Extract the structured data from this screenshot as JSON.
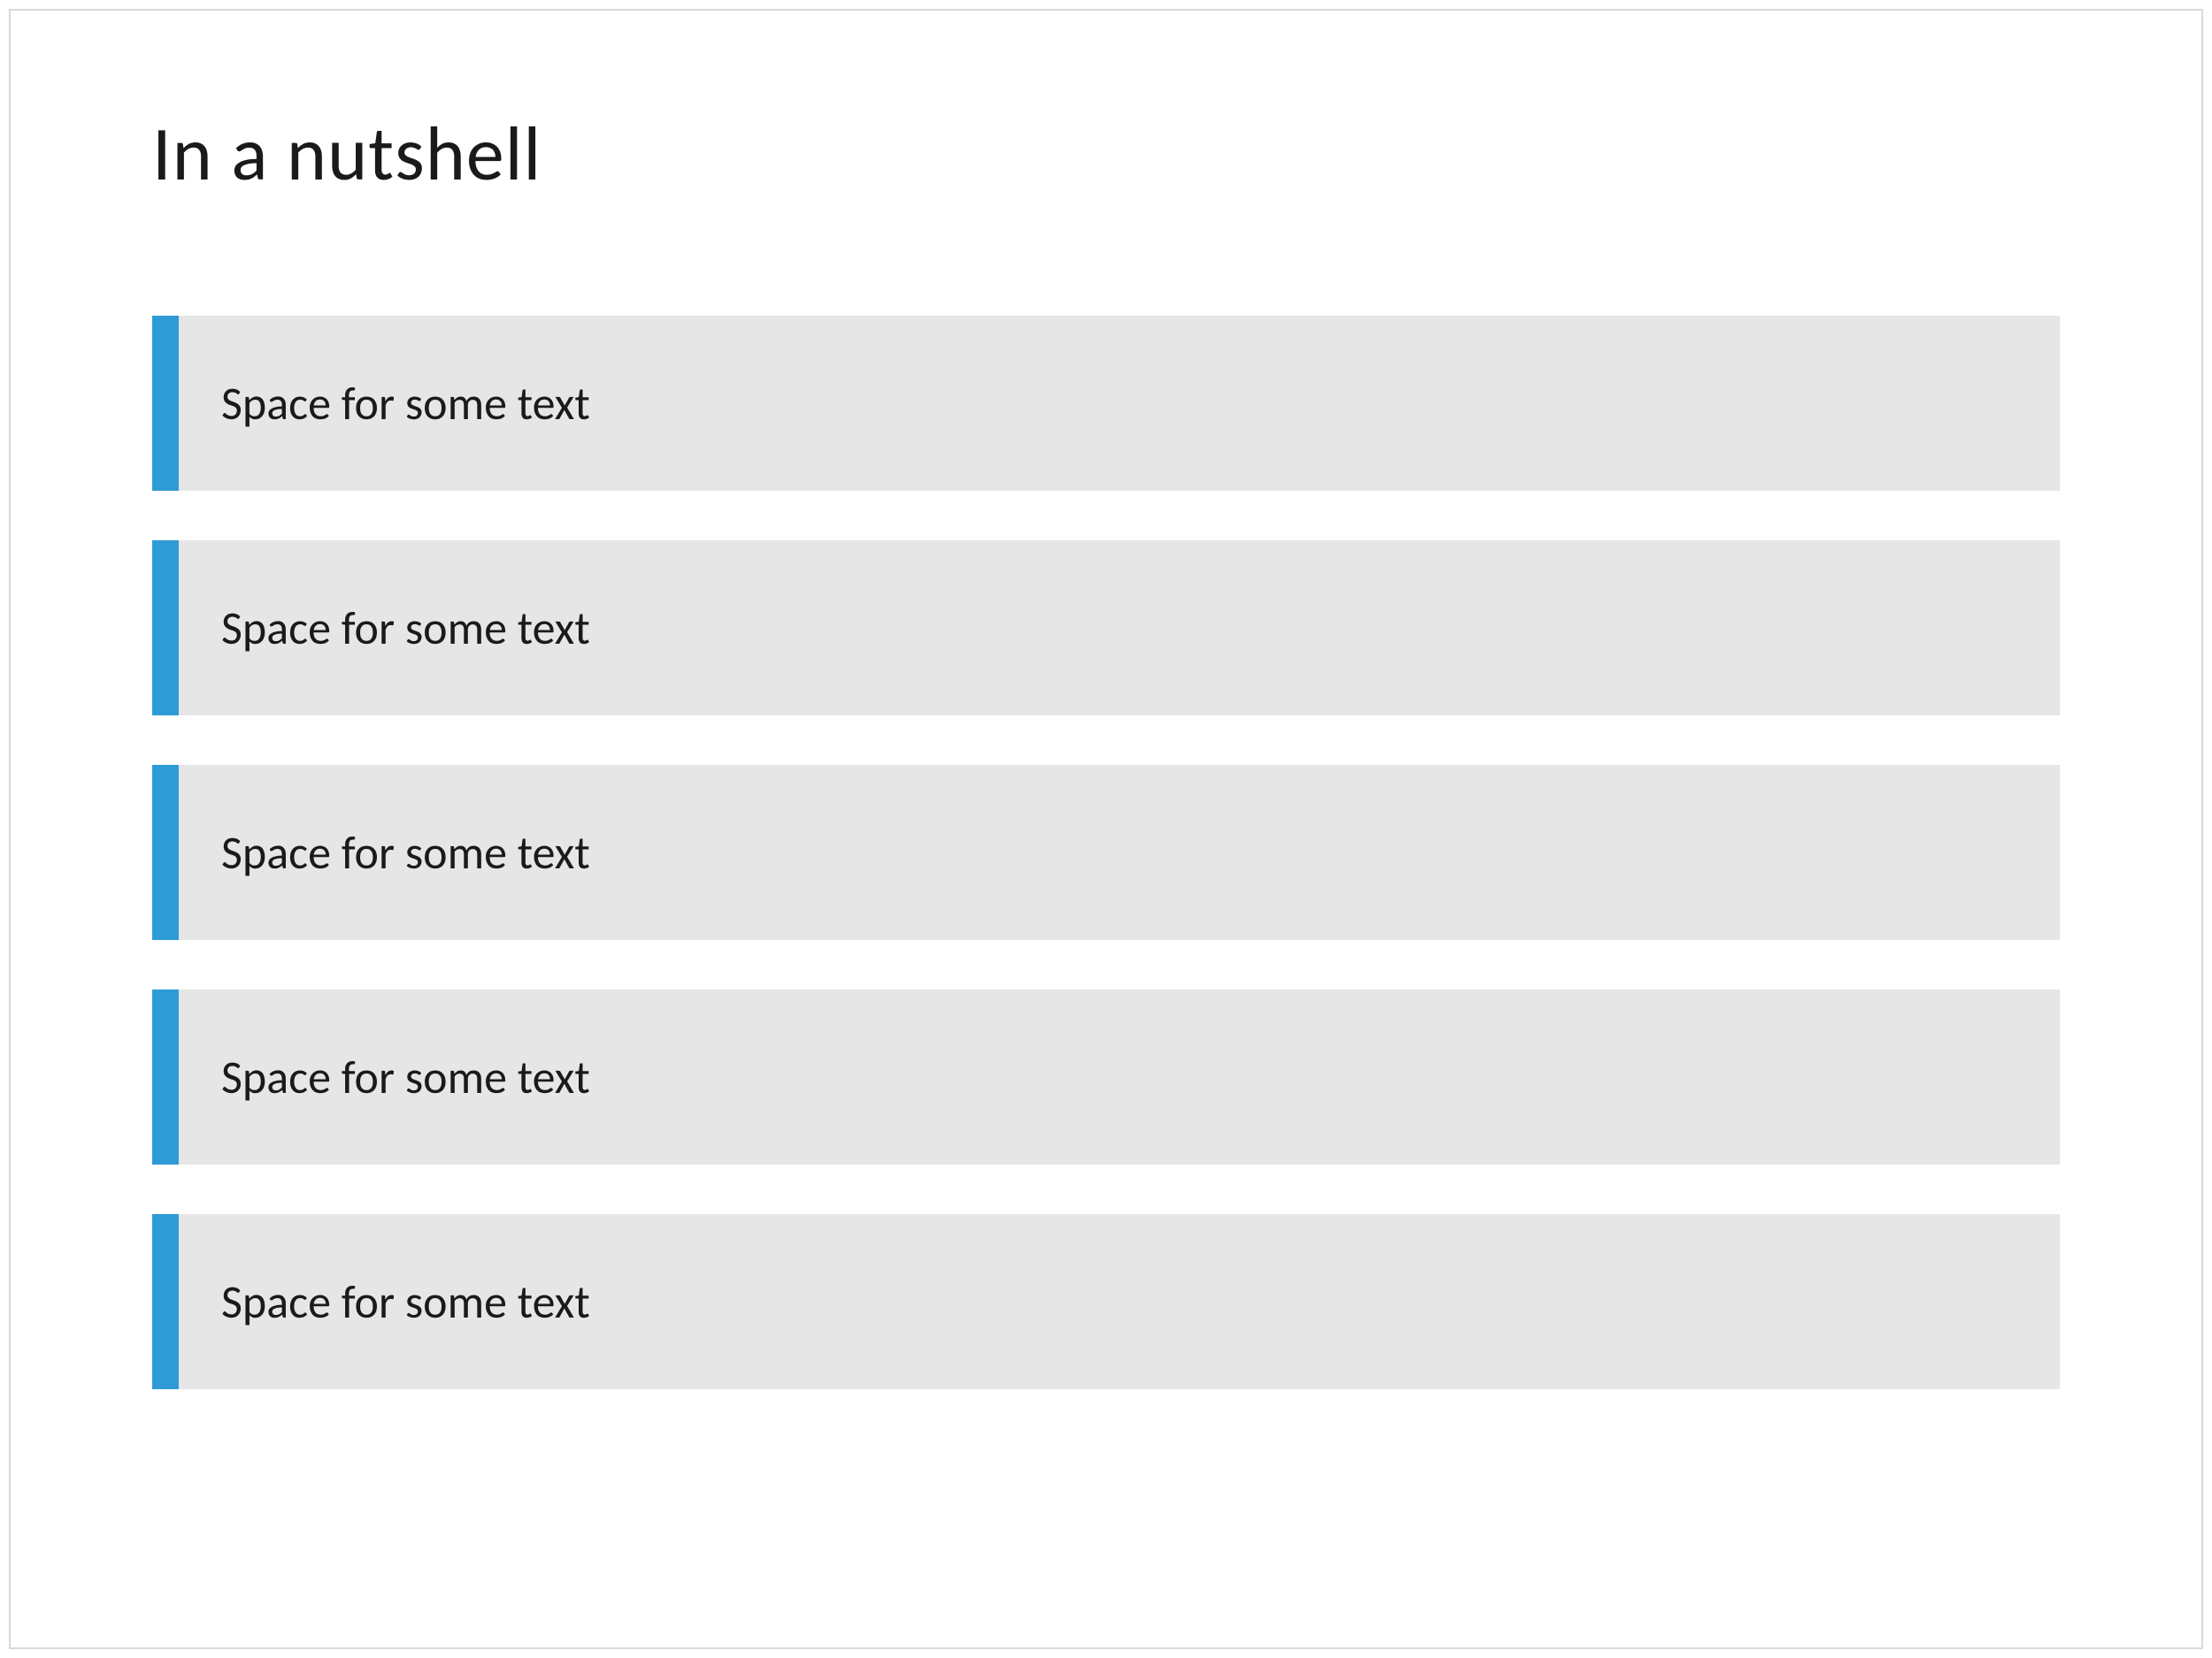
{
  "slide": {
    "title": "In a nutshell",
    "items": [
      {
        "text": "Space for some text"
      },
      {
        "text": "Space for some text"
      },
      {
        "text": "Space for some text"
      },
      {
        "text": "Space for some text"
      },
      {
        "text": "Space for some text"
      }
    ],
    "colors": {
      "accent": "#2e9bd6",
      "item_bg": "#e6e6e6",
      "border": "#d9d9d9",
      "text": "#1a1a1a"
    }
  }
}
